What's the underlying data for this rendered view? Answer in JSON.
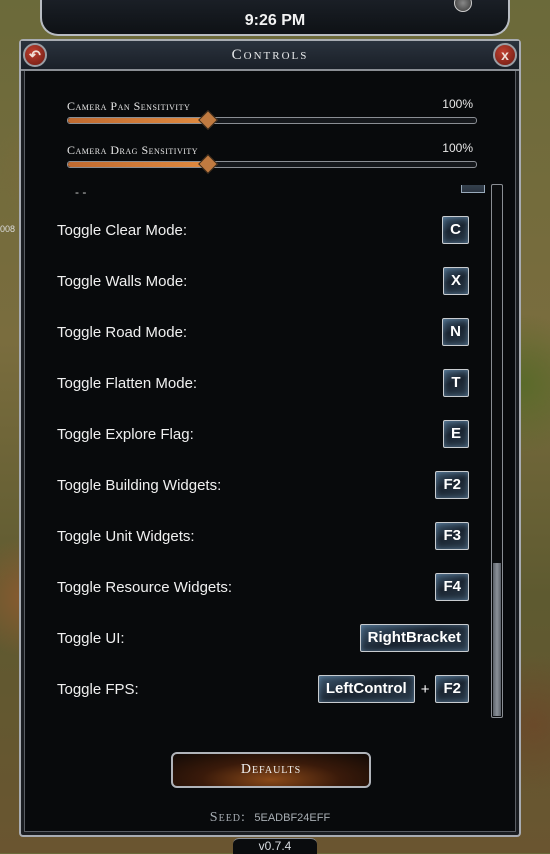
{
  "clock": "9:26 PM",
  "edge_text": "008",
  "window": {
    "title": "Controls",
    "back_icon": "back-arrow-icon",
    "close_icon": "close-x-icon",
    "back_symbol": "↶",
    "close_symbol": "x"
  },
  "sliders": [
    {
      "label": "Camera Pan Sensitivity",
      "value_text": "100%",
      "fill_percent": 34
    },
    {
      "label": "Camera Drag Sensitivity",
      "value_text": "100%",
      "fill_percent": 34
    }
  ],
  "partial_row_text": "- -",
  "bindings": [
    {
      "label": "Toggle Clear Mode:",
      "keys": [
        "C"
      ]
    },
    {
      "label": "Toggle Walls Mode:",
      "keys": [
        "X"
      ]
    },
    {
      "label": "Toggle Road Mode:",
      "keys": [
        "N"
      ]
    },
    {
      "label": "Toggle Flatten Mode:",
      "keys": [
        "T"
      ]
    },
    {
      "label": "Toggle Explore Flag:",
      "keys": [
        "E"
      ]
    },
    {
      "label": "Toggle Building Widgets:",
      "keys": [
        "F2"
      ]
    },
    {
      "label": "Toggle Unit Widgets:",
      "keys": [
        "F3"
      ]
    },
    {
      "label": "Toggle Resource Widgets:",
      "keys": [
        "F4"
      ]
    },
    {
      "label": "Toggle UI:",
      "keys": [
        "RightBracket"
      ]
    },
    {
      "label": "Toggle FPS:",
      "keys": [
        "LeftControl",
        "F2"
      ]
    }
  ],
  "key_separator": "+",
  "defaults_label": "Defaults",
  "seed": {
    "label": "Seed:",
    "value": "5EADBF24EFF"
  },
  "version": "v0.7.4",
  "colors": {
    "accent": "#e08a40",
    "panel": "#080a0c",
    "key_glow": "#8cbee6"
  }
}
